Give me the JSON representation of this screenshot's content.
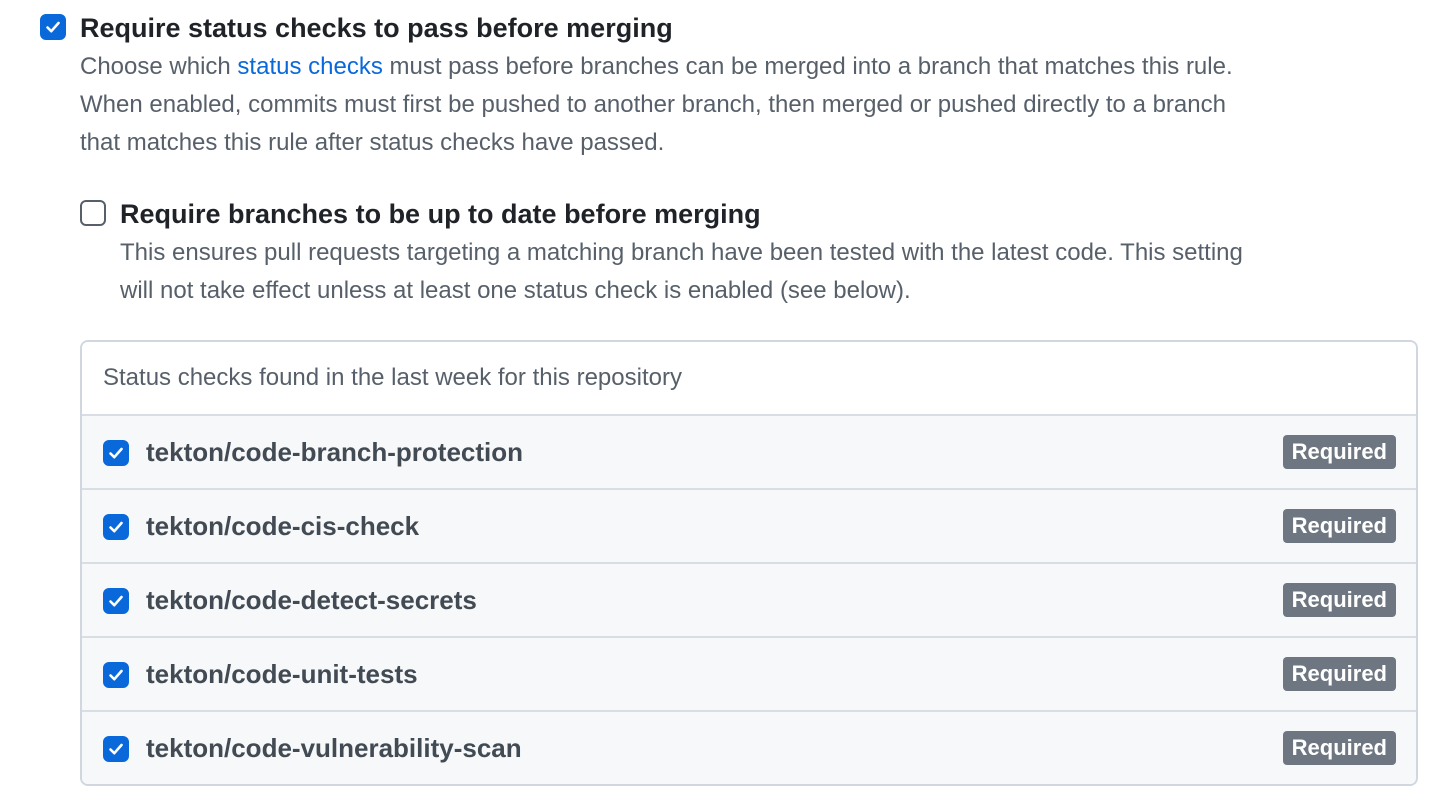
{
  "require_status_checks": {
    "title": "Require status checks to pass before merging",
    "checked": true,
    "desc_prefix": "Choose which ",
    "desc_link": "status checks",
    "desc_suffix_line1": " must pass before branches can be merged into a branch that matches this rule.",
    "desc_line2": "When enabled, commits must first be pushed to another branch, then merged or pushed directly to a branch",
    "desc_line3": "that matches this rule after status checks have passed."
  },
  "require_up_to_date": {
    "title": "Require branches to be up to date before merging",
    "checked": false,
    "desc_line1": "This ensures pull requests targeting a matching branch have been tested with the latest code. This setting",
    "desc_line2": "will not take effect unless at least one status check is enabled (see below)."
  },
  "status_checks_panel": {
    "header": "Status checks found in the last week for this repository",
    "checks": [
      {
        "name": "tekton/code-branch-protection",
        "checked": true,
        "badge": "Required"
      },
      {
        "name": "tekton/code-cis-check",
        "checked": true,
        "badge": "Required"
      },
      {
        "name": "tekton/code-detect-secrets",
        "checked": true,
        "badge": "Required"
      },
      {
        "name": "tekton/code-unit-tests",
        "checked": true,
        "badge": "Required"
      },
      {
        "name": "tekton/code-vulnerability-scan",
        "checked": true,
        "badge": "Required"
      }
    ]
  },
  "colors": {
    "accent": "#0969da",
    "badge_bg": "#6e7781",
    "row_bg": "#f6f8fa",
    "muted_text": "#57606a",
    "border": "#d0d7de"
  },
  "icons": {
    "checked_checkbox": "check-icon"
  }
}
